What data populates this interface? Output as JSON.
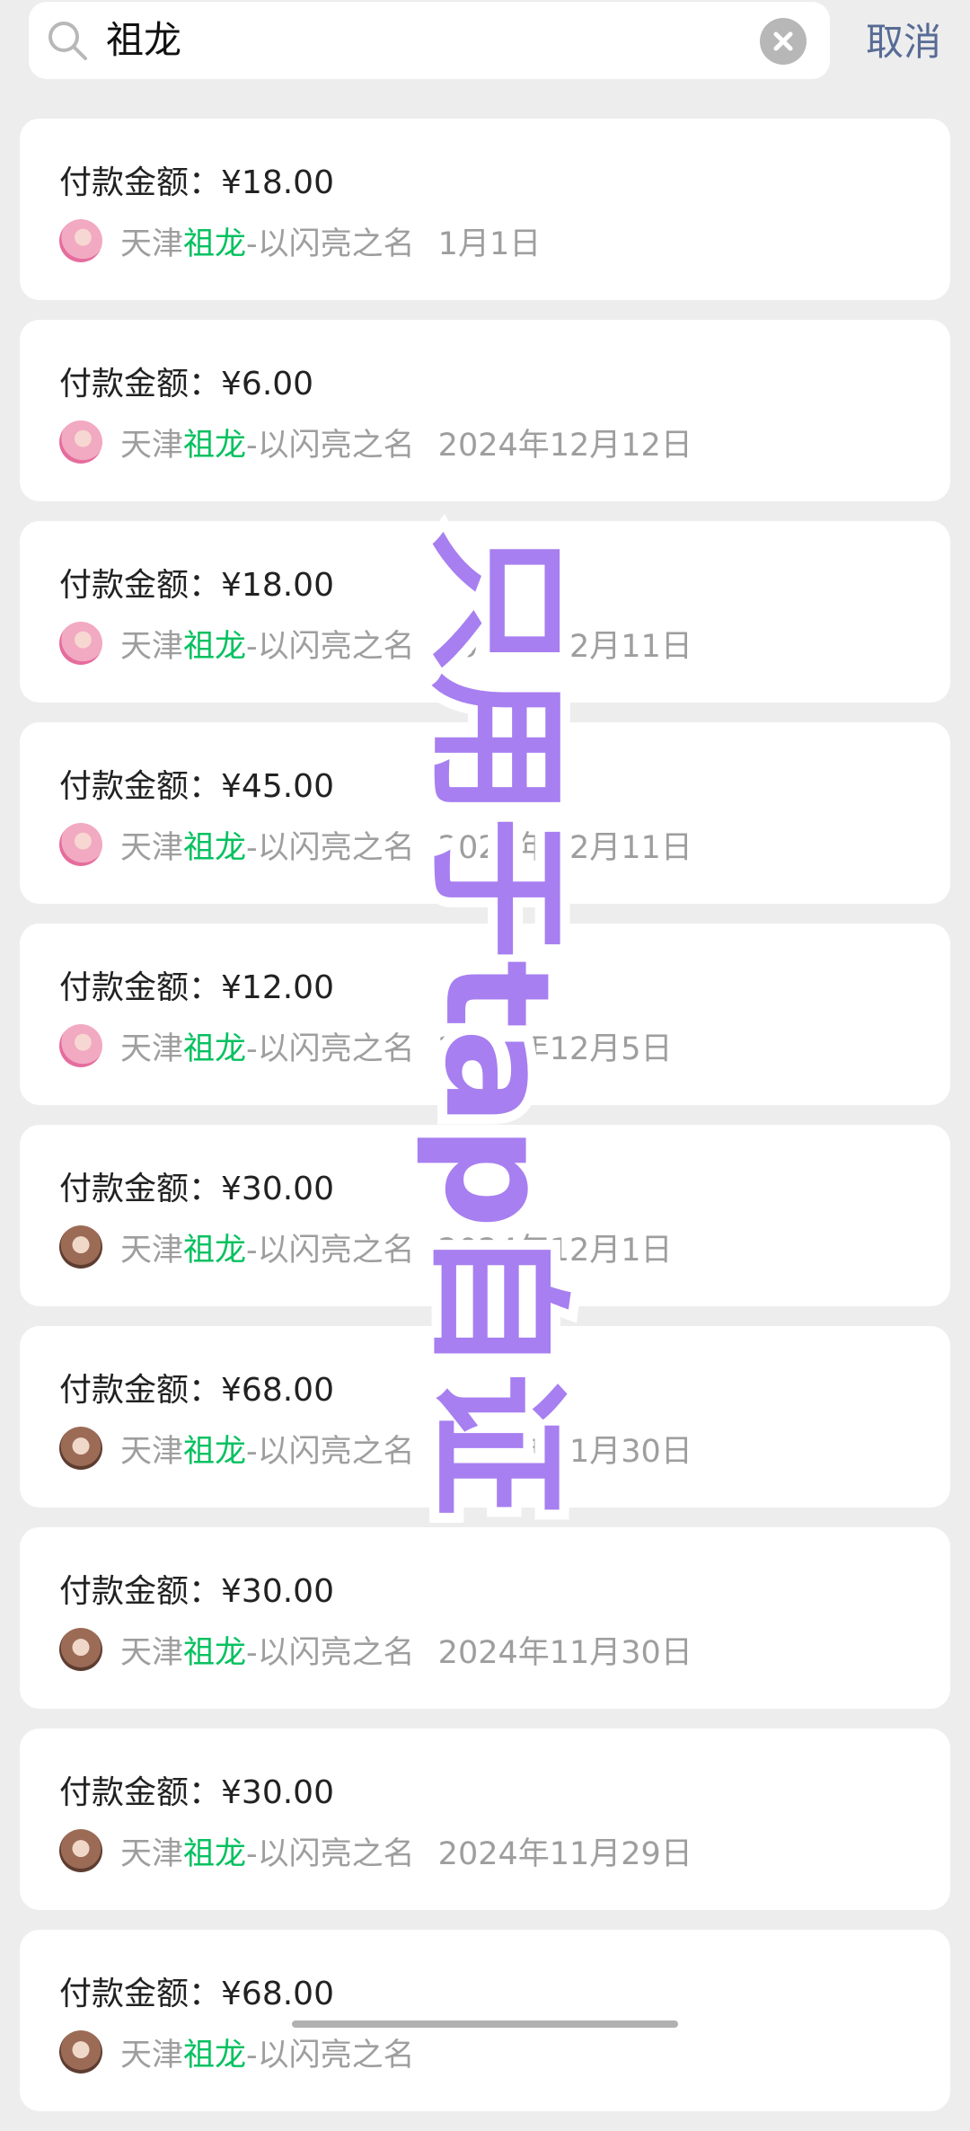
{
  "search": {
    "query": "祖龙",
    "cancel_label": "取消"
  },
  "colors": {
    "highlight": "#07c160",
    "cancel": "#576b95",
    "watermark_fill": "#a77ff0",
    "watermark_stroke": "#ffffff"
  },
  "labels": {
    "amount_prefix": "付款金额：",
    "payee_prefix": "天津",
    "payee_highlight": "祖龙",
    "payee_suffix": "-以闪亮之名"
  },
  "watermark_text": "只用于tap自证",
  "payments": [
    {
      "amount": "¥18.00",
      "date": "1月1日",
      "avatar": "pink"
    },
    {
      "amount": "¥6.00",
      "date": "2024年12月12日",
      "avatar": "pink"
    },
    {
      "amount": "¥18.00",
      "date": "2024年12月11日",
      "avatar": "pink"
    },
    {
      "amount": "¥45.00",
      "date": "2024年12月11日",
      "avatar": "pink"
    },
    {
      "amount": "¥12.00",
      "date": "2024年12月5日",
      "avatar": "pink"
    },
    {
      "amount": "¥30.00",
      "date": "2024年12月1日",
      "avatar": "brown"
    },
    {
      "amount": "¥68.00",
      "date": "2024年11月30日",
      "avatar": "brown"
    },
    {
      "amount": "¥30.00",
      "date": "2024年11月30日",
      "avatar": "brown"
    },
    {
      "amount": "¥30.00",
      "date": "2024年11月29日",
      "avatar": "brown"
    },
    {
      "amount": "¥68.00",
      "date": "",
      "avatar": "brown"
    }
  ]
}
